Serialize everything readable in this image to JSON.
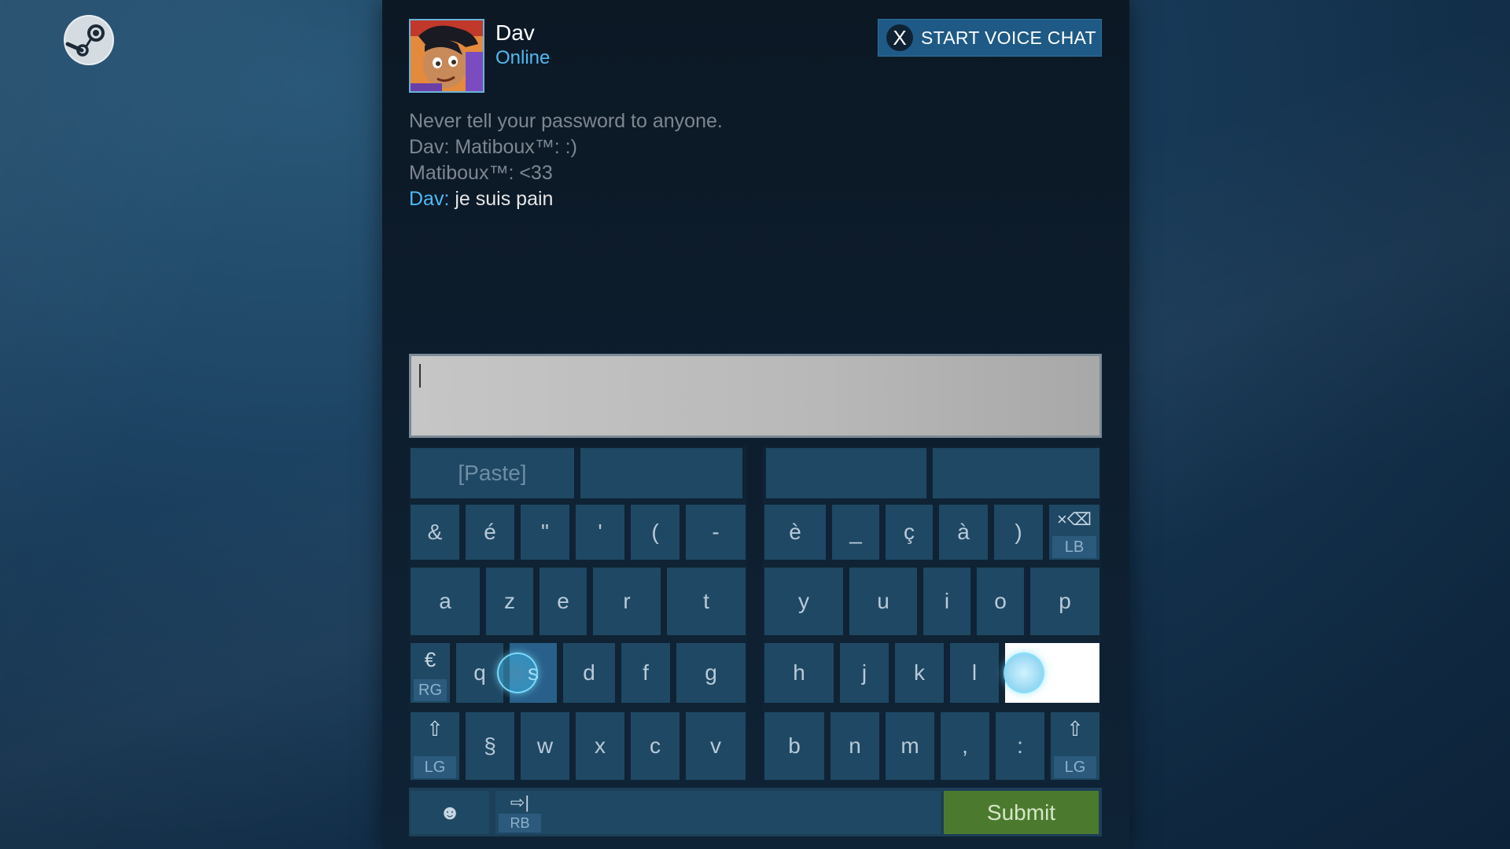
{
  "header": {
    "friend_name": "Dav",
    "friend_status": "Online",
    "voice_button_badge": "X",
    "voice_button_label": "START VOICE CHAT"
  },
  "chat": {
    "messages": [
      {
        "text": "Never tell your password to anyone."
      },
      {
        "text": "Dav: Matiboux™: :)"
      },
      {
        "text": "Matiboux™: <33"
      },
      {
        "who": "Dav:",
        "text": " je suis pain"
      }
    ]
  },
  "input": {
    "value": ""
  },
  "keyboard": {
    "left": {
      "top": [
        "[Paste]",
        ""
      ],
      "row1": [
        "&",
        "é",
        "\"",
        "'",
        "(",
        "-"
      ],
      "row2": [
        "a",
        "z",
        "e",
        "r",
        "t"
      ],
      "row3_mod": {
        "glyph": "€",
        "tag": "RG"
      },
      "row3": [
        "q",
        "s",
        "d",
        "f",
        "g"
      ],
      "row4_mod": {
        "glyph": "⇧",
        "tag": "LG"
      },
      "row4": [
        "§",
        "w",
        "x",
        "c",
        "v"
      ]
    },
    "right": {
      "top": [
        "",
        ""
      ],
      "row1": [
        "è",
        "_",
        "ç",
        "à",
        ")"
      ],
      "backspace": {
        "glyph": "×⌫",
        "tag": "LB"
      },
      "row2": [
        "y",
        "u",
        "i",
        "o",
        "p"
      ],
      "row3": [
        "h",
        "j",
        "k",
        "l"
      ],
      "row4": [
        "b",
        "n",
        "m",
        ",",
        ":"
      ],
      "row4_mod": {
        "glyph": "⇧",
        "tag": "LG"
      }
    },
    "bottom": {
      "emoji": "☻",
      "tab": {
        "glyph": "⇨|",
        "tag": "RB"
      },
      "submit": "Submit"
    }
  },
  "colors": {
    "accent": "#4eb9f2",
    "key": "#1f4864",
    "submit": "#4b7a2f"
  }
}
